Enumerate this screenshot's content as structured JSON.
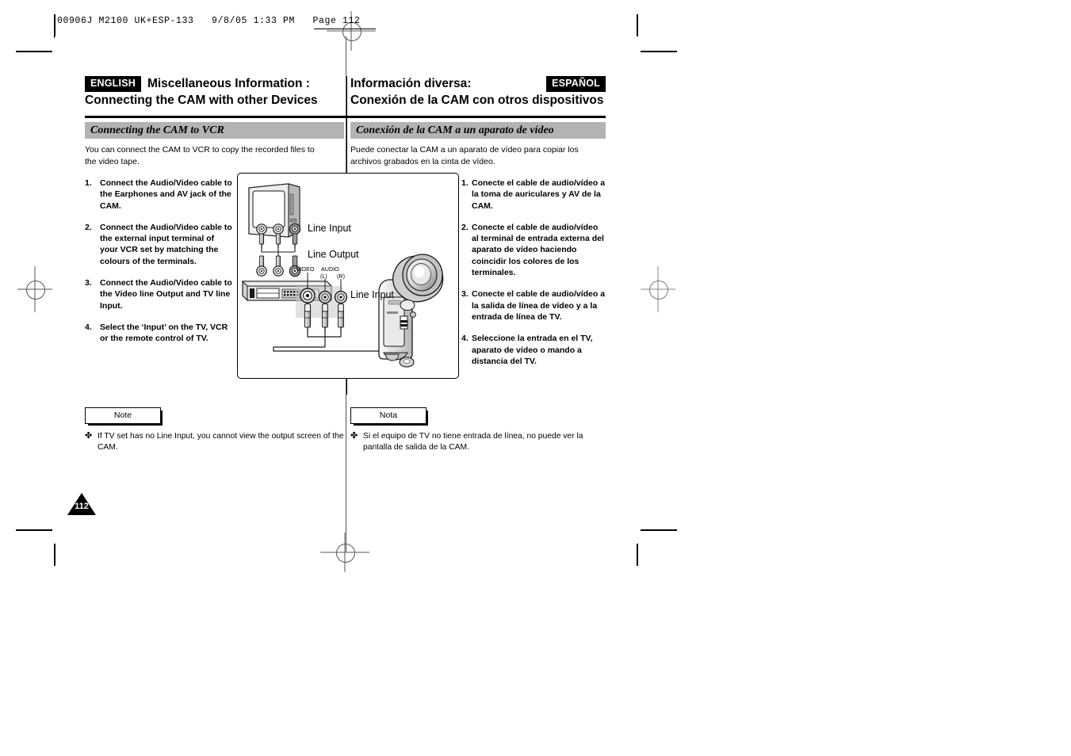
{
  "slug": {
    "text": "00906J M2100 UK+ESP-133   9/8/05 1:33 PM   Page 112"
  },
  "header": {
    "english_badge": "ENGLISH",
    "spanish_badge": "ESPAÑOL",
    "title_en_line1": "Miscellaneous Information :",
    "title_en_line2": "Connecting the CAM with other Devices",
    "title_es_line1": "Información diversa:",
    "title_es_line2": "Conexión de la CAM con otros dispositivos"
  },
  "section": {
    "subbar_en": "Connecting the CAM to VCR",
    "subbar_es": "Conexión de la CAM a un aparato de vídeo"
  },
  "english": {
    "intro": "You can connect the CAM to VCR to copy the recorded files to the video tape.",
    "steps": [
      {
        "num": "1.",
        "text": "Connect the Audio/Video cable to the Earphones and AV jack of the CAM."
      },
      {
        "num": "2.",
        "text": "Connect the Audio/Video cable to the external input terminal of your VCR set by matching the colours of the terminals."
      },
      {
        "num": "3.",
        "text": "Connect the Audio/Video cable to the Video line Output and TV line Input."
      },
      {
        "num": "4.",
        "text": "Select the ‘Input’ on the TV, VCR or the remote control of TV."
      }
    ],
    "note_label": "Note",
    "note_bullet": "✤",
    "note_text": "If TV set has no Line Input, you cannot view the output screen of the CAM."
  },
  "spanish": {
    "intro": "Puede conectar la CAM a un aparato de vídeo para copiar los archivos grabados en la cinta de vídeo.",
    "steps": [
      {
        "num": "1.",
        "text": "Conecte el cable de audio/vídeo a la toma de auriculares y AV de la CAM."
      },
      {
        "num": "2.",
        "text": "Conecte el cable de audio/vídeo al terminal de entrada externa del aparato de vídeo haciendo coincidir los colores de los terminales."
      },
      {
        "num": "3.",
        "text": "Conecte el cable de audio/vídeo a la salida de línea de vídeo y a la entrada de línea de TV."
      },
      {
        "num": "4.",
        "text": "Seleccione la entrada en el TV, aparato de vídeo o mando a distancia del TV."
      }
    ],
    "note_label": "Nota",
    "note_bullet": "✤",
    "note_text": "Si el equipo de TV no tiene entrada de línea, no puede ver la pantalla de salida de la CAM."
  },
  "diagram": {
    "label_line_input_top": "Line Input",
    "label_line_output": "Line Output",
    "label_line_input_cam": "Line Input",
    "label_video": "VIDEO",
    "label_audio": "AUDIO",
    "label_left": "(L)",
    "label_right": "(R)",
    "devices": {
      "tv": "tv-set",
      "vcr": "vcr-deck",
      "camcorder": "camcorder"
    }
  },
  "footer": {
    "page_number": "112"
  },
  "colors": {
    "subbar_gray": "#b3b3b3",
    "badge_black": "#000000",
    "device_gray": "#d9d9d9",
    "device_dark": "#8c8c8c"
  }
}
